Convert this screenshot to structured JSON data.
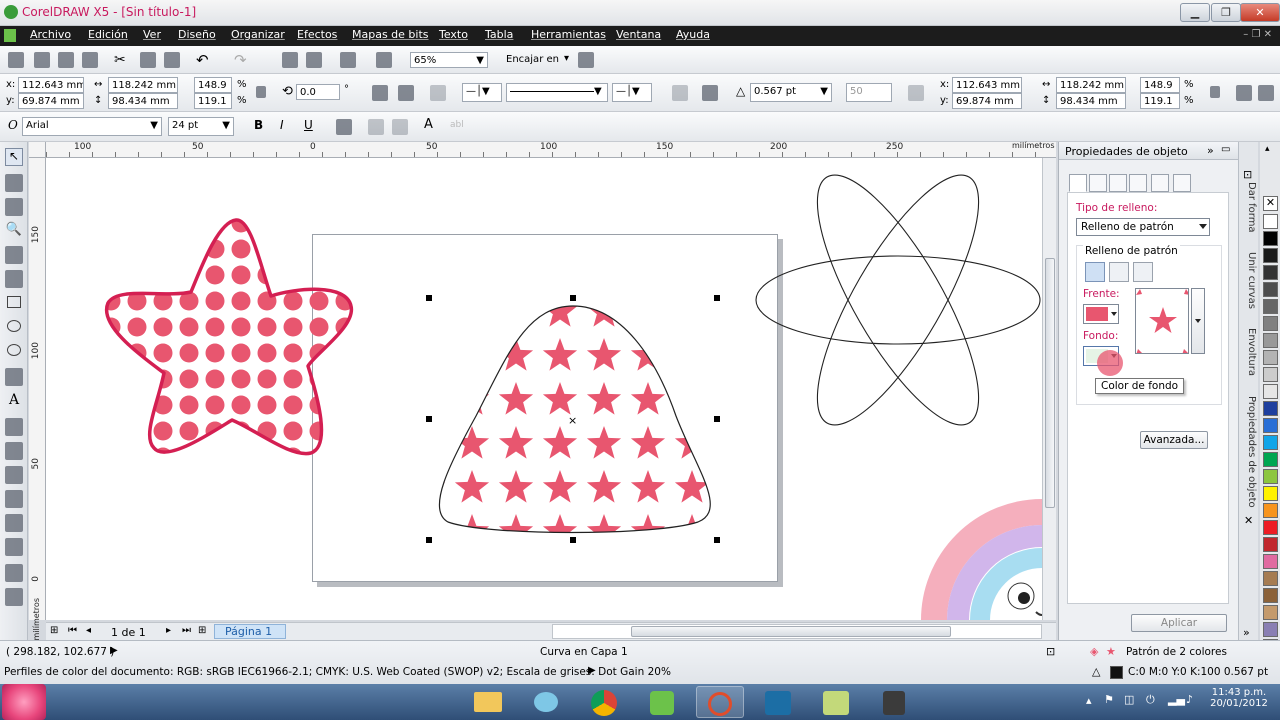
{
  "window": {
    "title": "CorelDRAW X5 - [Sin título-1]",
    "accent": "#c8195e"
  },
  "menu": [
    "Archivo",
    "Edición",
    "Ver",
    "Diseño",
    "Organizar",
    "Efectos",
    "Mapas de bits",
    "Texto",
    "Tabla",
    "Herramientas",
    "Ventana",
    "Ayuda"
  ],
  "standard_bar": {
    "zoom": "65%",
    "snap_label": "Encajar en"
  },
  "property_bar": {
    "x": "112.643 mm",
    "y": "69.874 mm",
    "w": "118.242 mm",
    "h": "98.434 mm",
    "scale_w": "148.9",
    "scale_h": "119.1",
    "pct": "%",
    "angle": "0.0",
    "deg": "°",
    "outline_width": "0.567 pt",
    "smooth": "50",
    "x2": "112.643 mm",
    "y2": "69.874 mm",
    "w2": "118.242 mm",
    "h2": "98.434 mm",
    "scale_w2": "148.9",
    "scale_h2": "119.1"
  },
  "text_bar": {
    "font": "Arial",
    "size": "24 pt"
  },
  "ruler": {
    "h_ticks": [
      "100",
      "50",
      "0",
      "50",
      "100",
      "150",
      "200",
      "250"
    ],
    "unit": "milímetros",
    "v_ticks": [
      "150",
      "100",
      "50",
      "0"
    ]
  },
  "page_nav": {
    "counter": "1 de 1",
    "tab": "Página 1"
  },
  "docker": {
    "title": "Propiedades de objeto",
    "fill_type_label": "Tipo de relleno:",
    "fill_type_value": "Relleno de patrón",
    "pattern_section": "Relleno de patrón",
    "front_label": "Frente:",
    "back_label": "Fondo:",
    "tooltip": "Color de fondo",
    "advanced_button": "Avanzada...",
    "apply_button": "Aplicar",
    "front_color": "#e8566f"
  },
  "side_tabs": [
    "Dar forma",
    "Unir curvas",
    "Envoltura",
    "Propiedades de objeto"
  ],
  "palette": [
    "#ffffff",
    "#000000",
    "#1a1a1a",
    "#333333",
    "#4d4d4d",
    "#666666",
    "#808080",
    "#999999",
    "#b3b3b3",
    "#cccccc",
    "#e6e6e6",
    "#1e3f9e",
    "#2a6fd6",
    "#12a5e8",
    "#00a651",
    "#8dc63f",
    "#fff200",
    "#f7941d",
    "#ed1c24",
    "#c1272d",
    "#e06aa0",
    "#a67c52",
    "#8c6239",
    "#c49a6c",
    "#8a7fb3",
    "#bfb3d9"
  ],
  "status": {
    "coords": "( 298.182, 102.677 )",
    "layer": "Curva en Capa 1",
    "fill_info": "Patrón de 2 colores",
    "profile": "Perfiles de color del documento: RGB: sRGB IEC61966-2.1; CMYK: U.S. Web Coated (SWOP) v2; Escala de grises: Dot Gain 20%",
    "outline_info": "C:0 M:0 Y:0 K:100  0.567 pt"
  },
  "taskbar": {
    "time": "11:43 p.m.",
    "date": "20/01/2012"
  },
  "shapes": {
    "pink": "#e8566f",
    "pink_dark": "#d41f52"
  }
}
